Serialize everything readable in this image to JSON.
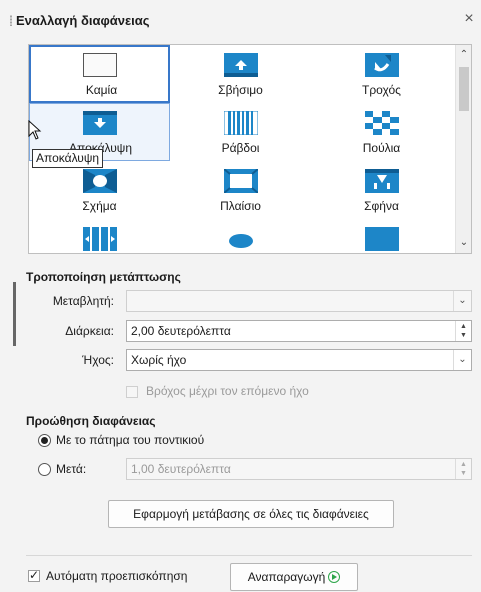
{
  "panel": {
    "title": "Εναλλαγή διαφάνειας",
    "close": "×"
  },
  "transitions": {
    "items": [
      {
        "label": "Καμία",
        "icon": "none-icon"
      },
      {
        "label": "Σβήσιμο",
        "icon": "wipe-icon"
      },
      {
        "label": "Τροχός",
        "icon": "wheel-icon"
      },
      {
        "label": "Αποκάλυψη",
        "icon": "uncover-icon"
      },
      {
        "label": "Ράβδοι",
        "icon": "bars-icon"
      },
      {
        "label": "Πούλια",
        "icon": "checkers-icon"
      },
      {
        "label": "Σχήμα",
        "icon": "shape-icon"
      },
      {
        "label": "Πλαίσιο",
        "icon": "box-icon"
      },
      {
        "label": "Σφήνα",
        "icon": "wedge-icon"
      },
      {
        "label": "",
        "icon": "venetian-icon"
      },
      {
        "label": "",
        "icon": "iris-icon"
      },
      {
        "label": "",
        "icon": "fade-icon"
      }
    ],
    "tooltip": "Αποκάλυψη",
    "colors": {
      "accent": "#1d86c8",
      "selected_border": "#3877c9"
    }
  },
  "modify": {
    "title": "Τροποποίηση μετάπτωσης",
    "variant_label": "Μεταβλητή:",
    "variant_value": "",
    "duration_label": "Διάρκεια:",
    "duration_value": "2,00 δευτερόλεπτα",
    "sound_label": "Ήχος:",
    "sound_value": "Χωρίς ήχο",
    "loop_label": "Βρόχος μέχρι τον επόμενο ήχο"
  },
  "advance": {
    "title": "Προώθηση διαφάνειας",
    "on_click_label": "Με το πάτημα του ποντικιού",
    "after_label": "Μετά:",
    "after_value": "1,00 δευτερόλεπτα"
  },
  "buttons": {
    "apply_all": "Εφαρμογή μετάβασης σε όλες τις διαφάνειες",
    "autopreview": "Αυτόματη προεπισκόπηση",
    "play": "Αναπαραγωγή"
  }
}
